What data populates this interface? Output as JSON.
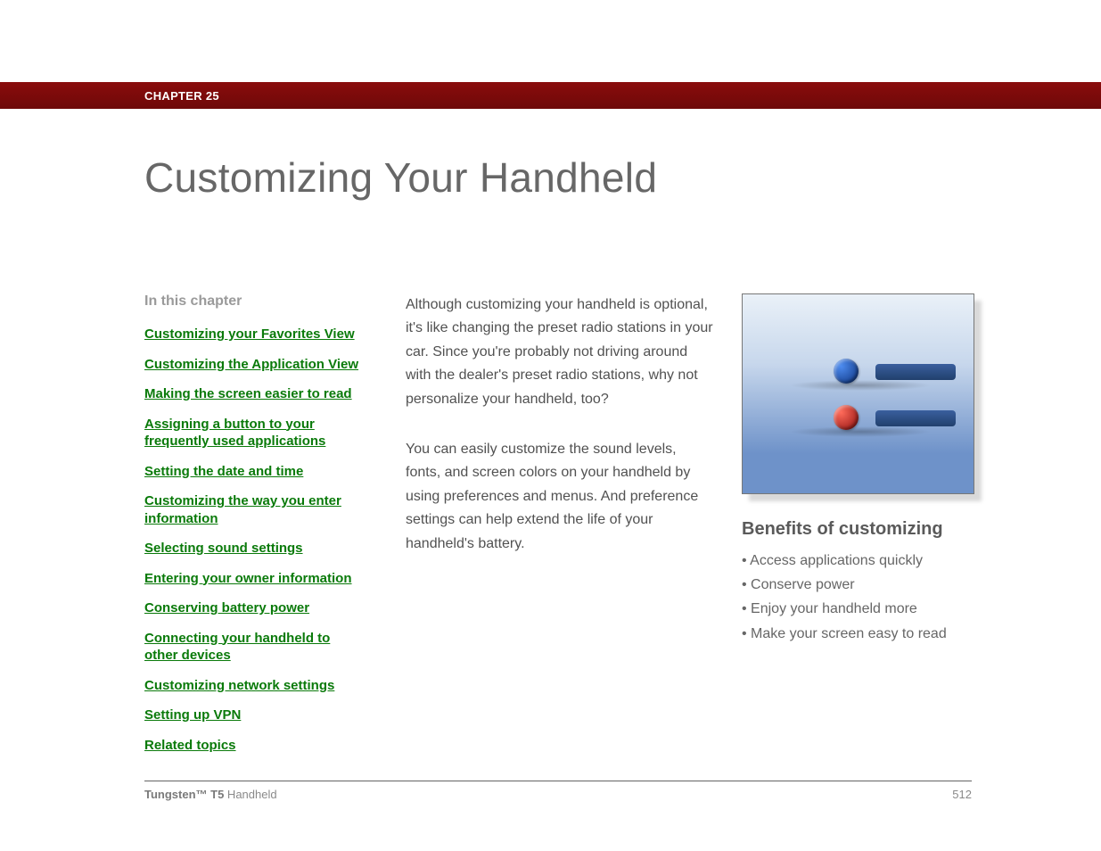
{
  "chapter_bar": {
    "label": "CHAPTER 25"
  },
  "page_title": "Customizing Your Handheld",
  "sidebar": {
    "heading": "In this chapter",
    "links": [
      "Customizing your Favorites View",
      "Customizing the Application View",
      "Making the screen easier to read",
      "Assigning a button to your frequently used applications",
      "Setting the date and time",
      "Customizing the way you enter information",
      "Selecting sound settings",
      "Entering your owner information",
      "Conserving battery power",
      "Connecting your handheld to other devices",
      "Customizing network settings",
      "Setting up VPN",
      "Related topics"
    ]
  },
  "body": {
    "para1": "Although customizing your handheld is optional, it's like changing the preset radio stations in your car. Since you're probably not driving around with the dealer's preset radio stations, why not personalize your handheld, too?",
    "para2": "You can easily customize the sound levels, fonts, and screen colors on your handheld by using preferences and menus. And preference settings can help extend the life of your handheld's battery."
  },
  "benefits": {
    "title": "Benefits of customizing",
    "items": [
      "Access applications quickly",
      "Conserve power",
      "Enjoy your handheld more",
      "Make your screen easy to read"
    ]
  },
  "footer": {
    "product_bold": "Tungsten™ T5",
    "product_rest": " Handheld",
    "page_number": "512"
  }
}
